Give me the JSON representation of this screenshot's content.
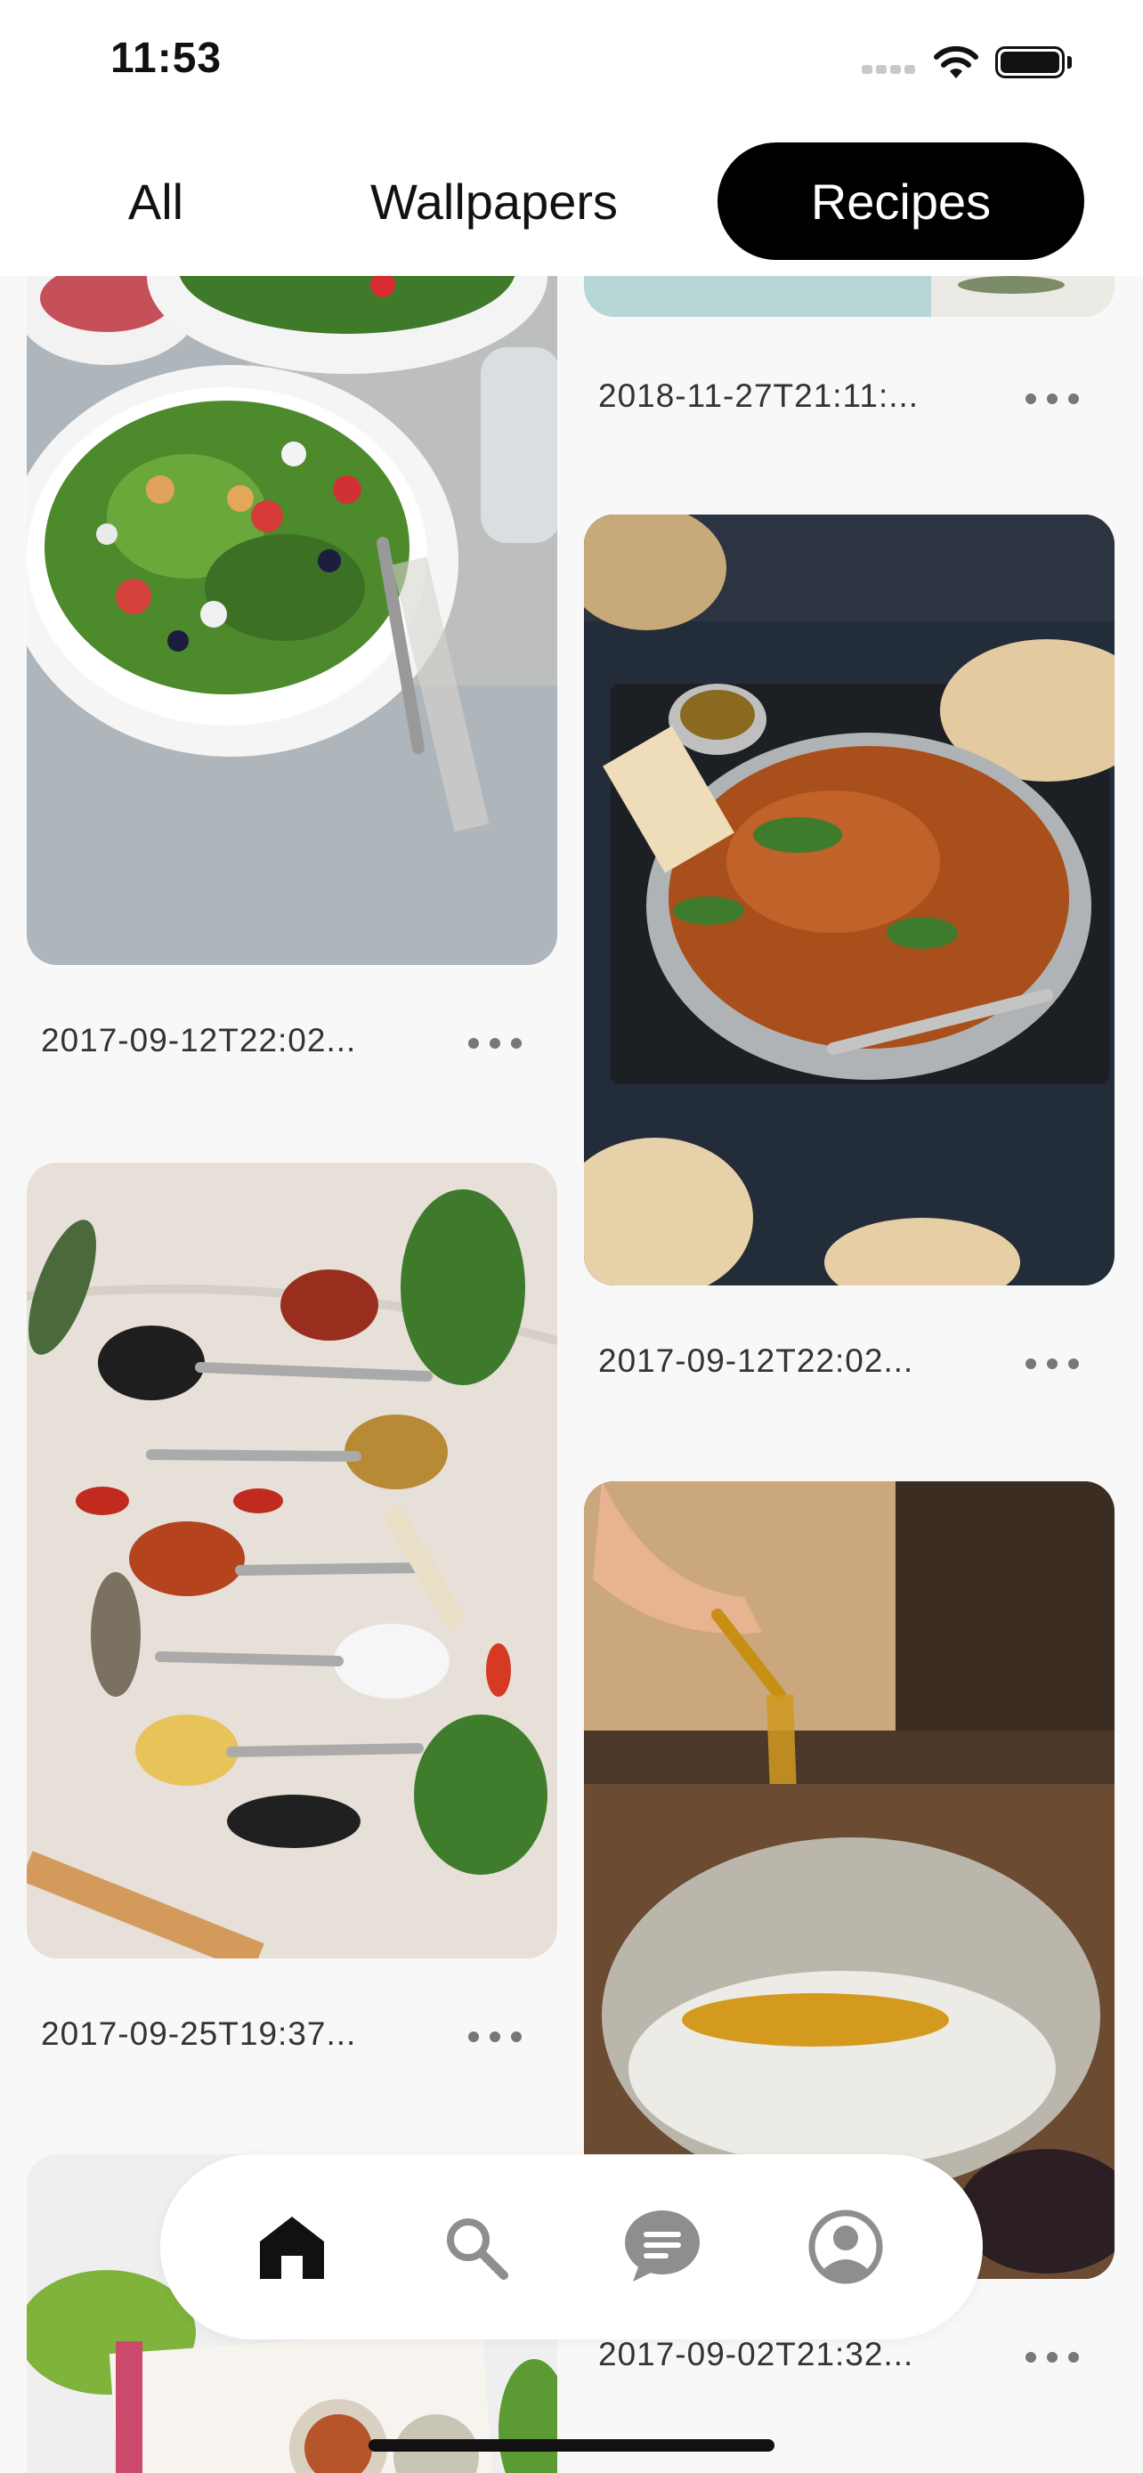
{
  "status_bar": {
    "time": "11:53"
  },
  "tabs": [
    {
      "label": "All",
      "active": false
    },
    {
      "label": "Wallpapers",
      "active": false
    },
    {
      "label": "Recipes",
      "active": true
    }
  ],
  "feed": {
    "left_column": [
      {
        "subject": "salad",
        "date": "2017-09-12T22:02..."
      },
      {
        "subject": "spices on spoons",
        "date": "2017-09-25T19:37..."
      },
      {
        "subject": "cookbook with greens",
        "date": ""
      }
    ],
    "right_column": [
      {
        "subject": "light blue table",
        "date": "2018-11-27T21:11:..."
      },
      {
        "subject": "curry with naan",
        "date": "2017-09-12T22:02..."
      },
      {
        "subject": "pouring turmeric into flour",
        "date": "2017-09-02T21:32..."
      }
    ]
  },
  "bottom_nav": {
    "items": [
      {
        "icon": "home-icon",
        "active": true
      },
      {
        "icon": "search-icon",
        "active": false
      },
      {
        "icon": "chat-icon",
        "active": false
      },
      {
        "icon": "profile-icon",
        "active": false
      }
    ],
    "colors": {
      "active": "#111111",
      "inactive": "#8e8e8e"
    }
  }
}
